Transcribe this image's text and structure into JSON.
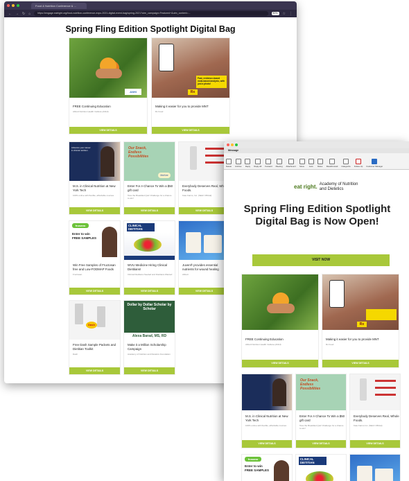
{
  "browser": {
    "tab_title": "Food & Nutrition Conference & ...",
    "url": "https://engage.eatright.org/food-nutrition-conference-expo-2021-digital-event-bag/spring-2021?utm_campaign=Featured+&utm_content=...",
    "zoom": "80%"
  },
  "page": {
    "title": "Spring Fling Edition Spotlight Digital Bag"
  },
  "cards": [
    {
      "title": "FREE Continuing Education",
      "subtitle": "Abbott Nutrition Health Institute (ANHI)",
      "button": "VIEW DETAILS",
      "logo": "ANHI"
    },
    {
      "title": "Making it easier for you to provide MNT",
      "subtitle": "Rx Food",
      "button": "VIEW DETAILS",
      "logo": "Rx",
      "overlay": "Fast, evidence-based meal-based analysis, with just a photo!"
    },
    {
      "title": "M.S. in Clinical Nutrition at New York Tech",
      "subtitle": "100% online with flexible, affordable courses",
      "button": "VIEW DETAILS",
      "overlay": "Advance your career in clinical nutrition"
    },
    {
      "title": "Enter For A Chance To Win a $50 gift card",
      "subtitle": "Toss the Breakfast Quiz Challenge for a chance to win!",
      "button": "VIEW DETAILS",
      "overlay": "Our Snack, Endless Possibilities",
      "logo": "McKee"
    },
    {
      "title": "Everybody Deserves Real, Whole Foods.",
      "subtitle": "Kate Farms, Inc. (SELF Official)",
      "button": "VIEW DETAILS"
    },
    {
      "title": "Win Free Samples of Fructosan free and Low-FODMAP Foods",
      "subtitle": "Fructosan",
      "button": "VIEW DETAILS",
      "overlay": "Enter to win FREE SAMPLES",
      "logo": "frusano"
    },
    {
      "title": "WVU Medicine Hiring Clinical Dietitians!",
      "subtitle": "Clinical Dietitians Needed and Dietitians Wanted",
      "button": "VIEW DETAILS",
      "overlay": "CLINICAL DIETITIAN"
    },
    {
      "title": "Juven® provides essential nutrients for wound healing",
      "subtitle": "Abbott",
      "button": "VIEW DETAILS"
    },
    {
      "title": "Free Dash Sample Packets and Dietitian Toolkit",
      "subtitle": "Dash",
      "button": "VIEW DETAILS",
      "logo": "Dash"
    },
    {
      "title": "Make it a Million Scholarship Campaign",
      "subtitle": "Academy of Nutrition and Dietetics Foundation",
      "button": "VIEW DETAILS",
      "overlay": "Dollar by Dollar Scholar by Scholar",
      "name": "Alexa Barad, MS, RD"
    }
  ],
  "email": {
    "tab_label": "Message",
    "ribbon": [
      "Delete",
      "Archive",
      "Reply",
      "Reply All",
      "Forward",
      "Meeting",
      "Attachment",
      "Move",
      "Junk",
      "Rules",
      "Read/Unread",
      "Categorize",
      "Follow Up",
      "Customer Manager"
    ],
    "logo_eat": "eat right.",
    "logo_text": "Academy of Nutrition and Dietetics",
    "headline": "Spring Fling Edition Spotlight Digital Bag is Now Open!",
    "visit_button": "VISIT NOW",
    "cards": [
      {
        "title": "FREE Continuing Education",
        "subtitle": "Abbott Nutrition Health Institute (ANHI)",
        "button": "VIEW DETAILS"
      },
      {
        "title": "Making it easier for you to provide MNT",
        "subtitle": "Rx Food",
        "button": "VIEW DETAILS"
      },
      {
        "title": "M.S. in Clinical Nutrition at New York Tech",
        "subtitle": "100% online with flexible, affordable courses",
        "button": "VIEW DETAILS"
      },
      {
        "title": "Enter For A Chance To Win a $50 gift card",
        "subtitle": "Toss the Breakfast Quiz Challenge for a chance to win!",
        "button": "VIEW DETAILS"
      },
      {
        "title": "Everybody Deserves Real, Whole Foods.",
        "subtitle": "Kate Farms Inc. (SELF Official)",
        "button": "VIEW DETAILS"
      }
    ]
  }
}
